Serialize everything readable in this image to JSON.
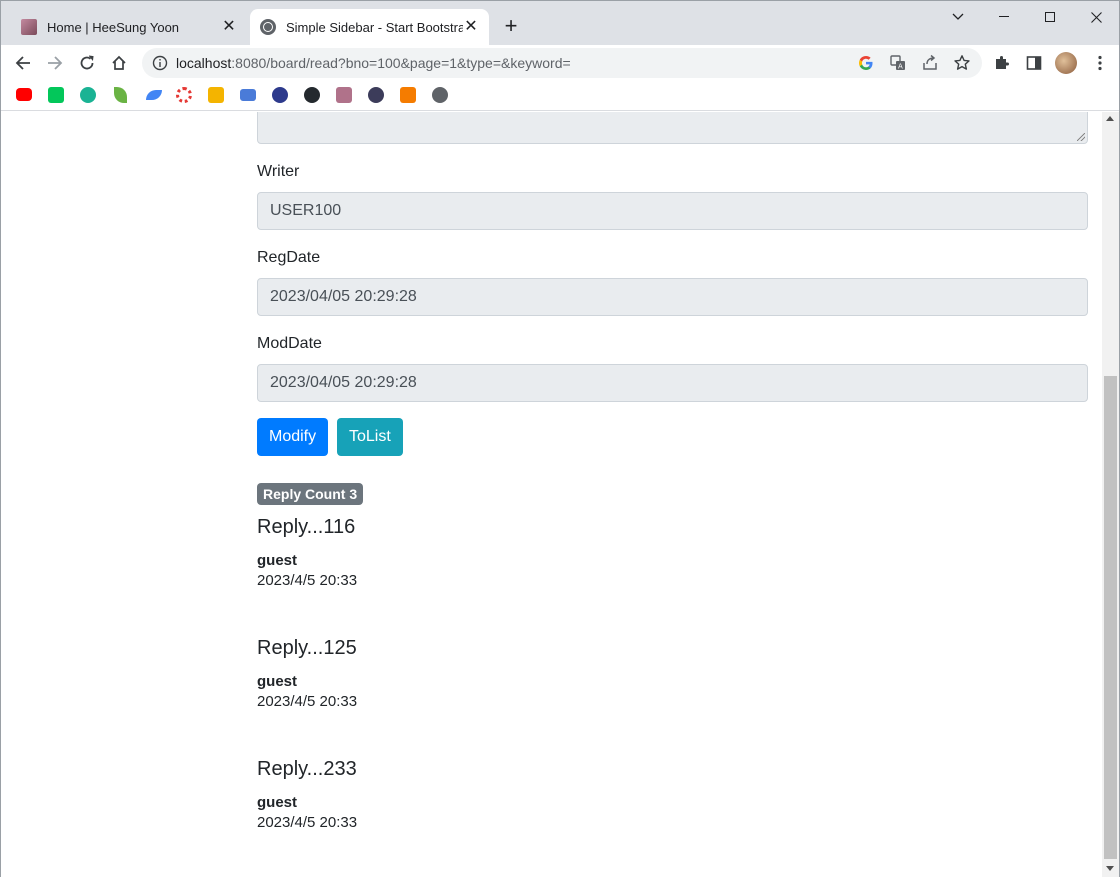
{
  "browser": {
    "tabs": [
      {
        "title": "Home | HeeSung Yoon",
        "close": "✕",
        "favicon": "avatar-favicon-icon"
      },
      {
        "title": "Simple Sidebar - Start Bootstrap",
        "close": "✕",
        "favicon": "globe-icon"
      }
    ],
    "new_tab": "+",
    "window_controls": {
      "collapse": "⌄",
      "minimize": "—",
      "maximize": "☐",
      "close": "✕"
    },
    "address": {
      "host": "localhost",
      "rest": ":8080/board/read?bno=100&page=1&type=&keyword="
    },
    "bookmarks": [
      {
        "icon": "youtube-icon",
        "color": "#ff0000"
      },
      {
        "icon": "naver-icon",
        "color": "#03c75a"
      },
      {
        "icon": "app-icon",
        "color": "#1ab394"
      },
      {
        "icon": "leaf-icon",
        "color": "#6ab344"
      },
      {
        "icon": "feather-icon",
        "color": "#4285f4"
      },
      {
        "icon": "lifebuoy-icon",
        "color": "#e53935"
      },
      {
        "icon": "classroom-icon",
        "color": "#f4b400"
      },
      {
        "icon": "kakao-icon",
        "color": "#4a7bd8"
      },
      {
        "icon": "owl-icon",
        "color": "#2d3a8c"
      },
      {
        "icon": "github-icon",
        "color": "#24292e"
      },
      {
        "icon": "avatar-bookmark-icon",
        "color": "#b0728a"
      },
      {
        "icon": "ghost-icon",
        "color": "#3c3c5a"
      },
      {
        "icon": "cube-icon",
        "color": "#f57c00"
      },
      {
        "icon": "globe-bookmark-icon",
        "color": "#5f6368"
      }
    ]
  },
  "form": {
    "writer": {
      "label": "Writer",
      "value": "USER100"
    },
    "regdate": {
      "label": "RegDate",
      "value": "2023/04/05 20:29:28"
    },
    "moddate": {
      "label": "ModDate",
      "value": "2023/04/05 20:29:28"
    },
    "modify_label": "Modify",
    "tolist_label": "ToList"
  },
  "replies": {
    "count_label": "Reply Count 3",
    "items": [
      {
        "title": "Reply...116",
        "writer": "guest",
        "date": "2023/4/5 20:33"
      },
      {
        "title": "Reply...125",
        "writer": "guest",
        "date": "2023/4/5 20:33"
      },
      {
        "title": "Reply...233",
        "writer": "guest",
        "date": "2023/4/5 20:33"
      }
    ]
  },
  "colors": {
    "primary": "#007bff",
    "info": "#17a2b8",
    "badge": "#6c757d",
    "readonly_bg": "#e9ecef"
  }
}
